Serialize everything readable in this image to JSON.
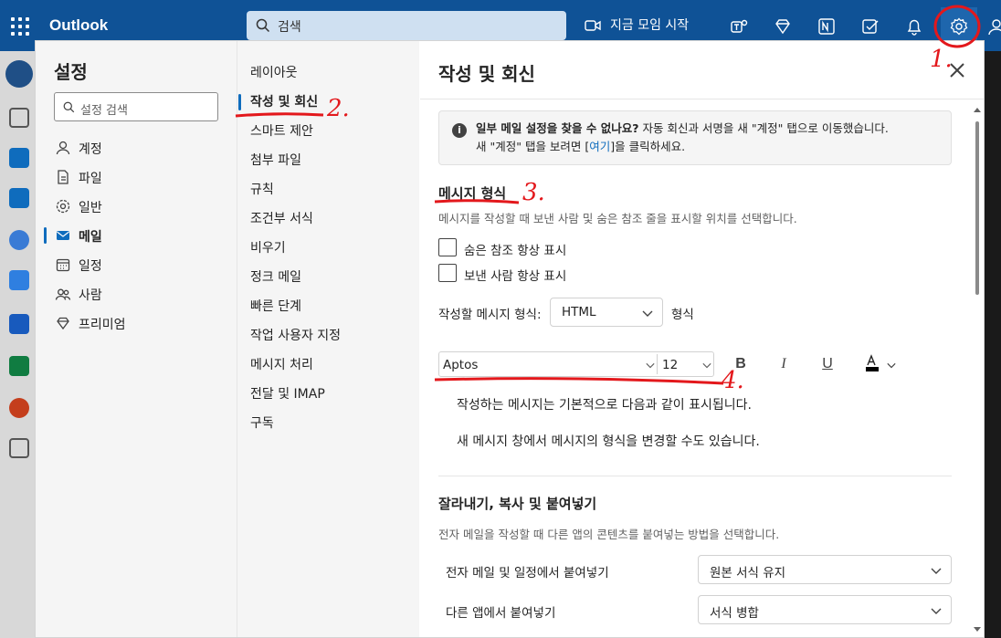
{
  "topbar": {
    "app_name": "Outlook",
    "search_placeholder": "검색",
    "meet_now": "지금 모임 시작"
  },
  "settings_nav": {
    "title": "설정",
    "search_placeholder": "설정 검색",
    "items": [
      {
        "label": "계정",
        "icon": "person-icon"
      },
      {
        "label": "파일",
        "icon": "file-icon"
      },
      {
        "label": "일반",
        "icon": "gear-icon"
      },
      {
        "label": "메일",
        "icon": "mail-icon",
        "selected": true
      },
      {
        "label": "일정",
        "icon": "calendar-icon"
      },
      {
        "label": "사람",
        "icon": "people-icon"
      },
      {
        "label": "프리미엄",
        "icon": "diamond-icon"
      }
    ]
  },
  "mail_nav": {
    "items": [
      {
        "label": "레이아웃"
      },
      {
        "label": "작성 및 회신",
        "selected": true
      },
      {
        "label": "스마트 제안"
      },
      {
        "label": "첨부 파일"
      },
      {
        "label": "규칙"
      },
      {
        "label": "조건부 서식"
      },
      {
        "label": "비우기"
      },
      {
        "label": "정크 메일"
      },
      {
        "label": "빠른 단계"
      },
      {
        "label": "작업 사용자 지정"
      },
      {
        "label": "메시지 처리"
      },
      {
        "label": "전달 및 IMAP"
      },
      {
        "label": "구독"
      }
    ]
  },
  "content": {
    "title": "작성 및 회신",
    "info": {
      "bold": "일부 메일 설정을 찾을 수 없나요?",
      "line1_rest": " 자동 회신과 서명을 새 \"계정\" 탭으로 이동했습니다.",
      "line2_before": "새 \"계정\" 탭을 보려면 [",
      "line2_link": "여기",
      "line2_after": "]을 클릭하세요."
    },
    "message_format": {
      "title": "메시지 형식",
      "description": "메시지를 작성할 때 보낸 사람 및 숨은 참조 줄을 표시할 위치를 선택합니다.",
      "checkbox_bcc": "숨은 참조 항상 표시",
      "checkbox_from": "보낸 사람 항상 표시",
      "compose_label": "작성할 메시지 형식:",
      "compose_value": "HTML",
      "compose_suffix": "형식",
      "font_name": "Aptos",
      "font_size": "12",
      "preview_line1": "작성하는 메시지는 기본적으로 다음과 같이 표시됩니다.",
      "preview_line2": "새 메시지 창에서 메시지의 형식을 변경할 수도 있습니다."
    },
    "cut_copy_paste": {
      "title": "잘라내기, 복사 및 붙여넣기",
      "description": "전자 메일을 작성할 때 다른 앱의 콘텐츠를 붙여넣는 방법을 선택합니다.",
      "row1_label": "전자 메일 및 일정에서 붙여넣기",
      "row1_value": "원본 서식 유지",
      "row2_label": "다른 앱에서 붙여넣기",
      "row2_value": "서식 병합"
    }
  },
  "annotations": {
    "num1": "1.",
    "num2": "2.",
    "num3": "3.",
    "num4": "4."
  },
  "colors": {
    "topbar": "#0f5296",
    "accent": "#0f6cbd",
    "annotation": "#e3181c"
  }
}
